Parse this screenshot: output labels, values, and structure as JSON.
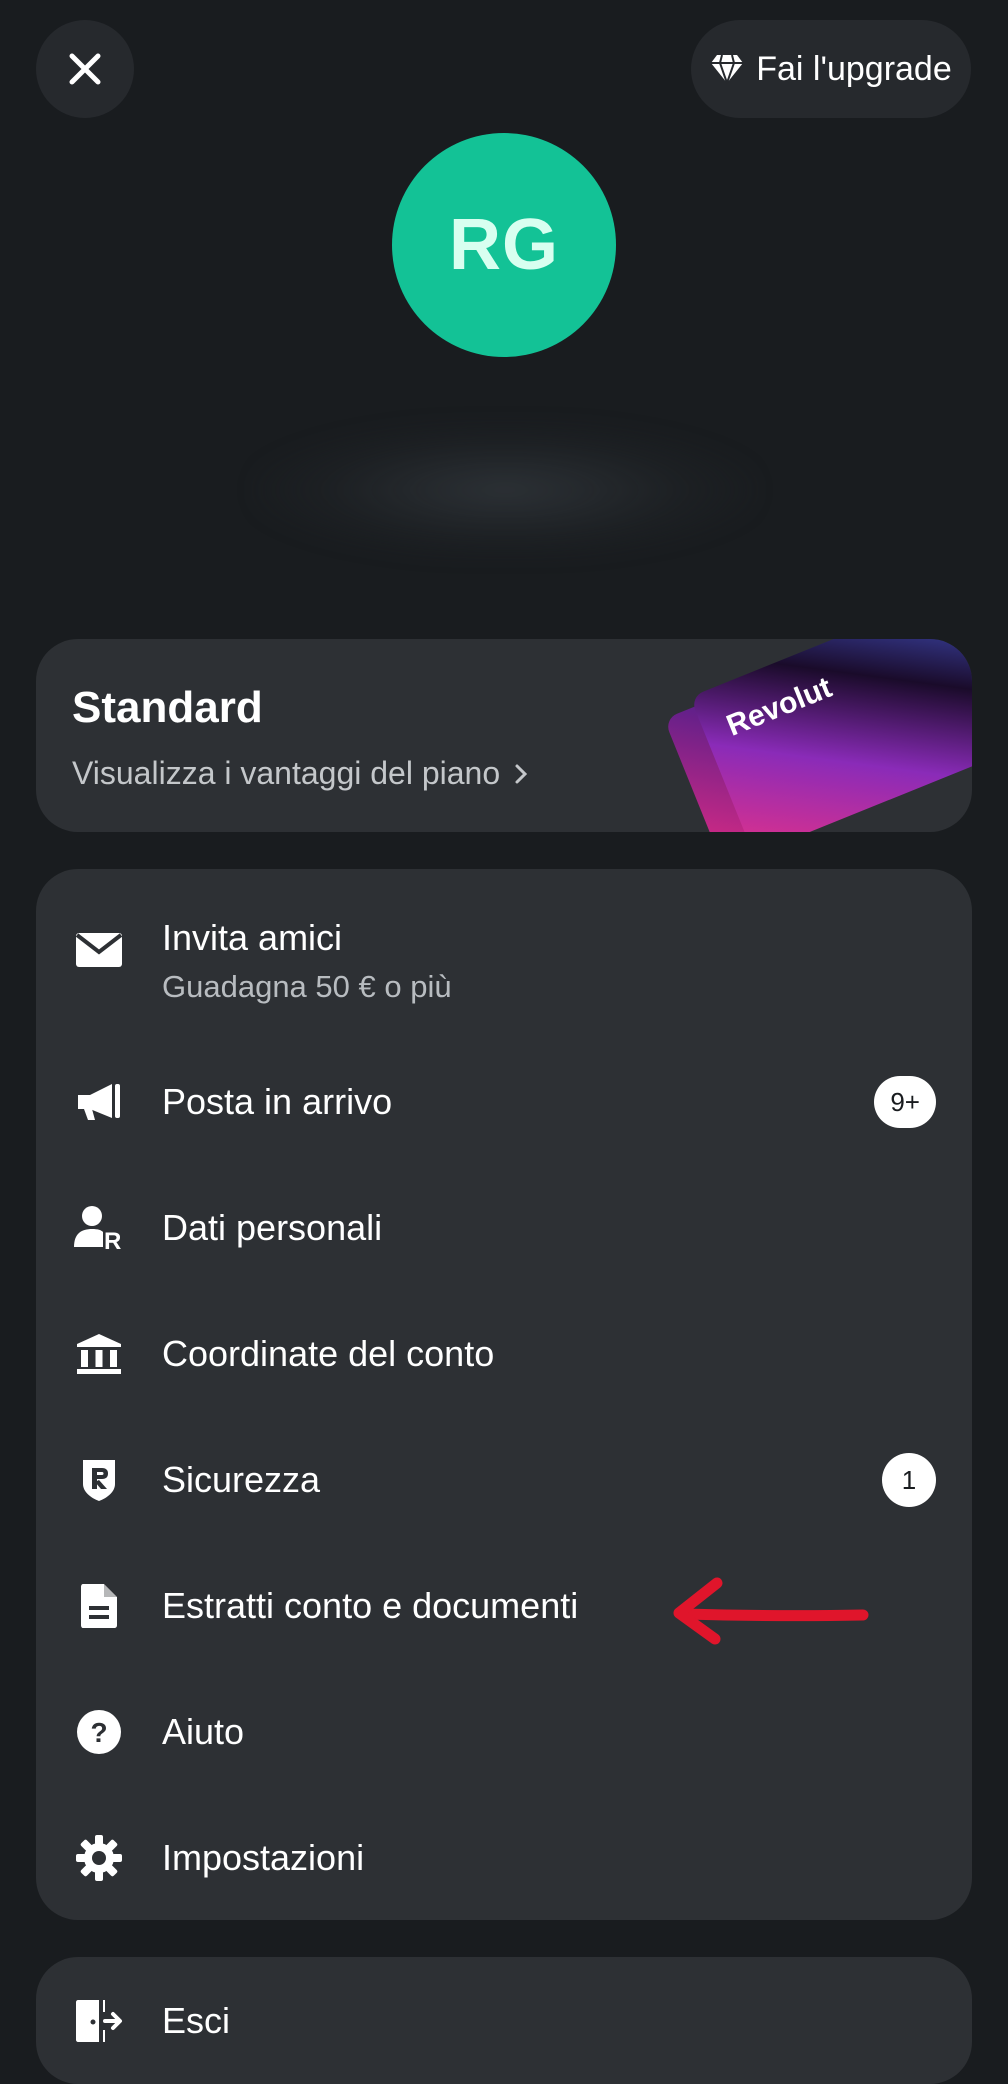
{
  "header": {
    "upgrade_label": "Fai l'upgrade",
    "close_icon": "close-icon",
    "upgrade_icon": "diamond-icon"
  },
  "profile": {
    "initials": "RG",
    "avatar_color": "#13c296"
  },
  "plan": {
    "title": "Standard",
    "subtitle": "Visualizza i vantaggi del piano",
    "card_brand": "Revolut"
  },
  "menu": {
    "items": [
      {
        "icon": "envelope-icon",
        "label": "Invita amici",
        "sublabel": "Guadagna 50 € o più"
      },
      {
        "icon": "megaphone-icon",
        "label": "Posta in arrivo",
        "badge": "9+"
      },
      {
        "icon": "user-r-icon",
        "label": "Dati personali"
      },
      {
        "icon": "bank-icon",
        "label": "Coordinate del conto"
      },
      {
        "icon": "shield-r-icon",
        "label": "Sicurezza",
        "badge": "1"
      },
      {
        "icon": "document-icon",
        "label": "Estratti conto e documenti"
      },
      {
        "icon": "help-icon",
        "label": "Aiuto"
      },
      {
        "icon": "gear-icon",
        "label": "Impostazioni"
      }
    ]
  },
  "logout": {
    "icon": "logout-door-icon",
    "label": "Esci"
  },
  "colors": {
    "background": "#191c1f",
    "card": "#2d3034",
    "annotation_arrow": "#e0152b"
  }
}
